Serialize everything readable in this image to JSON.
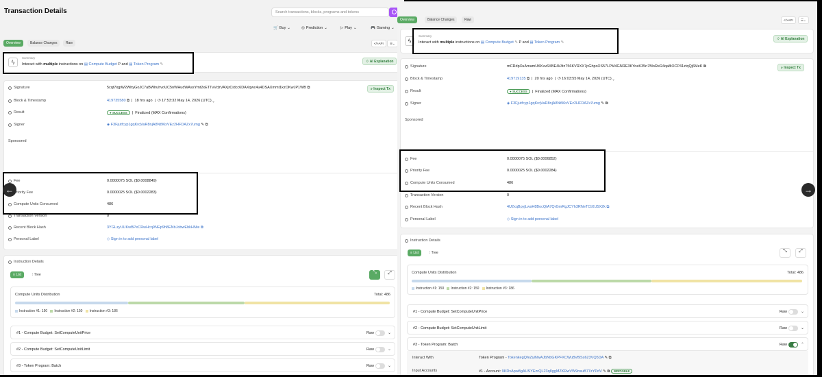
{
  "left": {
    "title": "Transaction Details",
    "search_placeholder": "Search transactions, blocks, programs and tokens",
    "nav": [
      "Buy",
      "Prediction",
      "Play",
      "Gaming"
    ],
    "tabs": [
      "Overview",
      "Balance Changes",
      "Raw"
    ],
    "api_btn": "API",
    "summary": {
      "label": "Summary",
      "pre": "Interact with",
      "bold": "multiple",
      "mid": "instructions on",
      "prog1": "Compute Budget",
      "p": "P",
      "and": "and",
      "prog2": "Token Program",
      "ai": "AI Explanation"
    },
    "inspect": "Inspect Tx",
    "fields": {
      "signature_label": "Signature",
      "signature": "5cqt7iqpW2WhyGoJC7aBWhuhvoUC5nWHudWAssYmt2xETTvVdzVAXjrCidcc6DAXqwc4u4DSAXmmt1kzOKwJP1WB",
      "block_label": "Block & Timestamp",
      "block": "419735580",
      "ago": "18 hrs ago",
      "time": "17:53:32 May 14, 2026 (UTC)",
      "result_label": "Result",
      "success": "SUCCESS",
      "finalized": "Finalized (MAX Confirmations)",
      "signer_label": "Signer",
      "signer": "F3Fjutfcyp1gqKrqVaR8njA8Nt96xVEz2HFDAZx7umg",
      "sponsored_label": "Sponsored",
      "fee_label": "Fee",
      "fee": "0.0000075 SOL ($0.0008849)",
      "priority_label": "Priority Fee",
      "priority": "0.0000025 SOL ($0.0002283)",
      "cu_label": "Compute Units Consumed",
      "cu": "486",
      "version_label": "Transaction Version",
      "version": "0",
      "hash_label": "Recent Block Hash",
      "hash": "3YGLzyUUKwBPxCRwHcq9NEp9h8ENbJobwEbkHNte",
      "personal_label": "Personal Label",
      "personal": "Sign in to add personal label"
    },
    "instr": {
      "title": "Instruction Details",
      "list": "List",
      "tree": "Tree",
      "cu_dist": "Compute Units Distribution",
      "total": "Total: 486",
      "legend": [
        "Instruction #1: 150",
        "Instruction #2: 150",
        "Instruction #3: 186"
      ],
      "rows": [
        "#1 - Compute Budget: SetComputeUnitPrice",
        "#2 - Compute Budget: SetComputeUnitLimit",
        "#3 - Token Program: Batch"
      ],
      "raw": "Raw"
    }
  },
  "right": {
    "search_placeholder": "",
    "api_btn": "API",
    "tabs": [
      "Overview",
      "Balance Changes",
      "Raw"
    ],
    "summary": {
      "label": "Summary",
      "pre": "Interact with",
      "bold": "multiple",
      "mid": "instructions on",
      "prog1": "Compute Budget",
      "p": "P",
      "and": "and",
      "prog2": "Token Program",
      "ai": "AI Explanation"
    },
    "inspect": "Inspect Tx",
    "fields": {
      "signature_label": "Signature",
      "signature": "mCRdpXuAmamUKKvv6XBE4k3tz756KVRXX7pGhpoXS57LPM4GNRE3KYoeK35n7MoReR4qa8tXCP41ztqQj6MeK",
      "block_label": "Block & Timestamp",
      "block": "419719135",
      "ago": "20 hrs ago",
      "time": "16:03:55 May 14, 2026 (UTC)",
      "result_label": "Result",
      "success": "SUCCESS",
      "finalized": "Finalized (MAX Confirmations)",
      "signer_label": "Signer",
      "signer": "F3Fjutfcyp1gqKrqVaR8njA8Nt96xVEz2HFDAZx7umg",
      "sponsored_label": "Sponsored",
      "fee_label": "Fee",
      "fee": "0.0000075 SOL ($0.0006852)",
      "priority_label": "Priority Fee",
      "priority": "0.0000025 SOL ($0.0002284)",
      "cu_label": "Compute Units Consumed",
      "cu": "486",
      "version_label": "Transaction Version",
      "version": "0",
      "hash_label": "Recent Block Hash",
      "hash": "4U2xqBpyjLwsH8BocQtA7QrGmRgJCYh3RNeTCtXU5X2k",
      "personal_label": "Personal Label",
      "personal": "Sign in to add personal label"
    },
    "instr": {
      "title": "Instruction Details",
      "list": "List",
      "tree": "Tree",
      "cu_dist": "Compute Units Distribution",
      "total": "Total: 486",
      "legend": [
        "Instruction #1: 150",
        "Instruction #2: 150",
        "Instruction #3: 186"
      ],
      "rows": [
        "#1 - Compute Budget: SetComputeUnitPrice",
        "#2 - Compute Budget: SetComputeUnitLimit",
        "#3 - Token Program: Batch"
      ],
      "raw": "Raw",
      "interact_label": "Interact With",
      "interact_val": "Token Program -",
      "interact_addr": "TokenkegQfeZyiNwAJbNbGKPFXCWuBvf9Ss623VQ5DA",
      "accounts_label": "Input Accounts",
      "accounts_val": "#1 - Account:",
      "accounts_addr": "9KDvApw8gAUSYEzrQL23q8ggMZKRwVW9nsuB77zYPdV",
      "writable": "WRITABLE"
    }
  },
  "colors": {
    "accent": "#5aaa64",
    "link": "#3b73c9",
    "bar1": "#c7d9ec",
    "bar2": "#bcd9a8",
    "bar3": "#f0e3a4",
    "purple": "#a855f7"
  }
}
